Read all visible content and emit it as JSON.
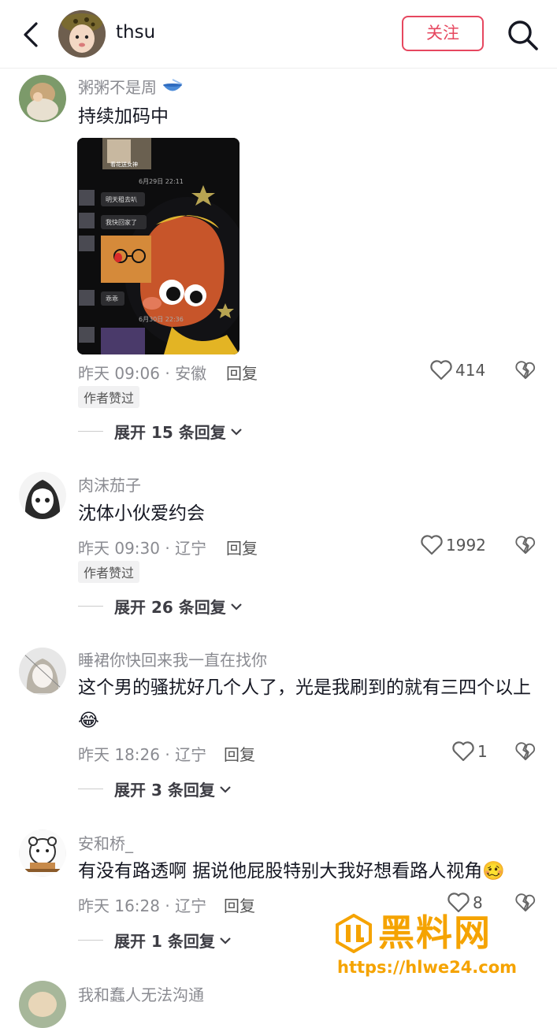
{
  "header": {
    "username": "thsu",
    "follow_label": "关注"
  },
  "comments": [
    {
      "user": "粥粥不是周",
      "text": "持续加码中",
      "time": "昨天 09:06 · 安徽",
      "reply_label": "回复",
      "likes": "414",
      "badge": "作者赞过",
      "expand": "展开 15 条回复",
      "image": {
        "date1": "6月29日 22:11",
        "msg1": "明天租去叭",
        "msg2": "我快回家了",
        "sticker_caption": "看花送女神",
        "msg3": "乖乖",
        "date2": "6月30日 22:36"
      }
    },
    {
      "user": "肉沫茄子",
      "text": "沈体小伙爱约会",
      "time": "昨天 09:30 · 辽宁",
      "reply_label": "回复",
      "likes": "1992",
      "badge": "作者赞过",
      "expand": "展开 26 条回复"
    },
    {
      "user": "睡裙你快回来我一直在找你",
      "text": "这个男的骚扰好几个人了，光是我刷到的就有三四个以上😂",
      "time": "昨天 18:26 · 辽宁",
      "reply_label": "回复",
      "likes": "1",
      "expand": "展开 3 条回复"
    },
    {
      "user": "安和桥_",
      "text": "有没有路透啊 据说他屁股特别大我好想看路人视角🥴",
      "time": "昨天 16:28 · 辽宁",
      "reply_label": "回复",
      "likes": "8",
      "expand": "展开 1 条回复"
    },
    {
      "user": "我和蠢人无法沟通"
    }
  ],
  "watermark": {
    "brand": "黑料网",
    "url": "https://hlwe24.com"
  },
  "colors": {
    "accent": "#e6475f",
    "watermark": "#f5a300"
  }
}
